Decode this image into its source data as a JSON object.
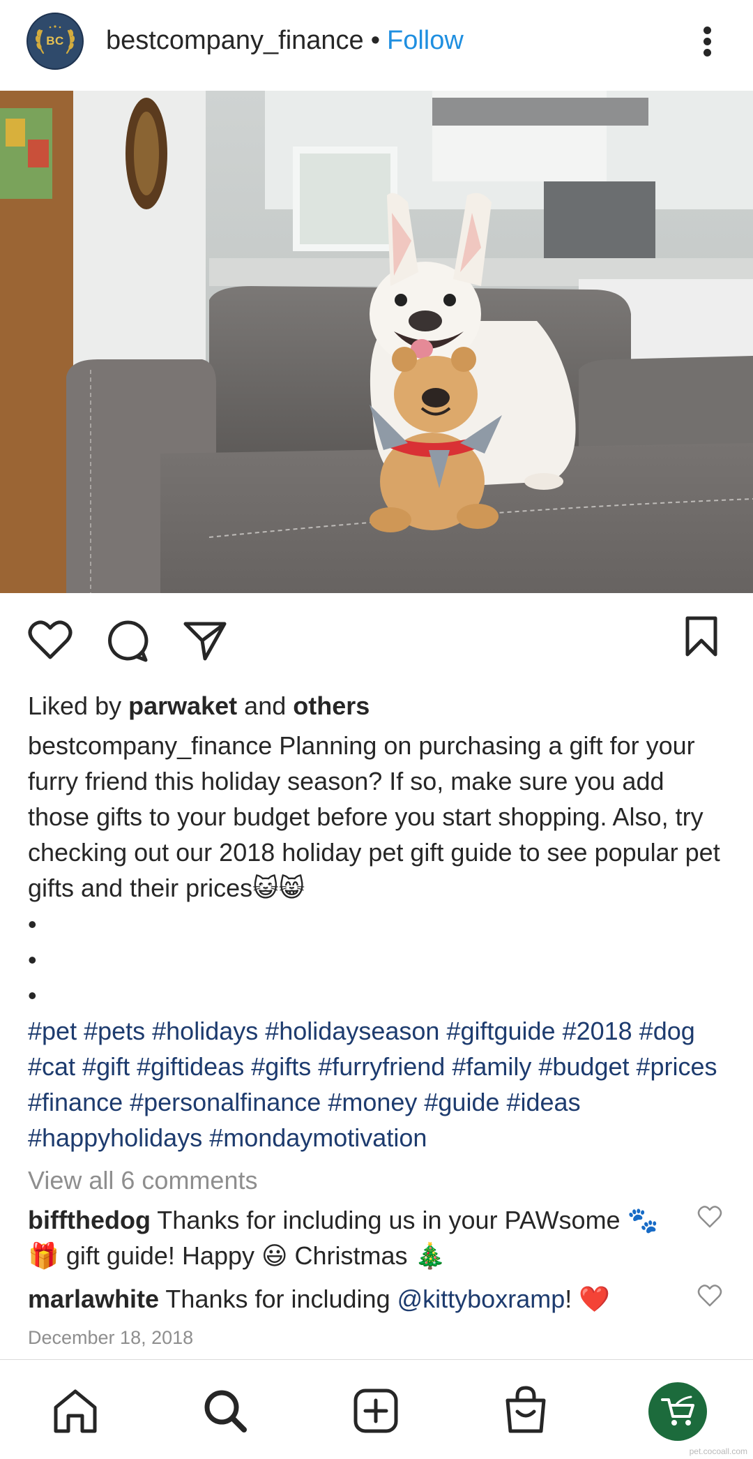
{
  "post": {
    "avatar_initials": "BC",
    "username": "bestcompany_finance",
    "separator": "•",
    "follow_label": "Follow"
  },
  "photo": {
    "icon": "photo-french-bulldog-with-plush-toy-on-couch"
  },
  "actions": {
    "like_icon": "heart-icon",
    "comment_icon": "comment-bubble-icon",
    "share_icon": "send-paper-plane-icon",
    "save_icon": "bookmark-icon"
  },
  "likes": {
    "prefix": "Liked by ",
    "user": "parwaket",
    "middle": " and ",
    "others": "others"
  },
  "caption": {
    "username": "bestcompany_finance",
    "text": " Planning on purchasing a gift for your furry friend this holiday season? If so, make sure you add those gifts to your budget before you start shopping. Also, try checking out our 2018 holiday pet gift guide to see popular pet gifts and their prices😺😸",
    "bullets": [
      "•",
      "•",
      "•"
    ],
    "hashtags": "#pet #pets #holidays #holidayseason #giftguide #2018 #dog #cat #gift #giftideas #gifts #furryfriend #family #budget #prices #finance #personalfinance #money #guide #ideas #happyholidays #mondaymotivation"
  },
  "comments": {
    "view_all": "View all 6 comments",
    "items": [
      {
        "user": "biffthedog",
        "text": " Thanks for including us in your PAWsome 🐾 🎁 gift guide! Happy 😃 Christmas 🎄"
      },
      {
        "user": "marlawhite",
        "text_before": " Thanks for including ",
        "mention": "@kittyboxramp",
        "text_after": "! ❤️"
      }
    ]
  },
  "date": "December 18, 2018",
  "nav": {
    "items": [
      "home-icon",
      "search-icon",
      "create-post-icon",
      "shopping-bag-icon",
      "profile-shopping-cart-icon"
    ]
  },
  "watermark": "pet.cocoall.com",
  "colors": {
    "follow": "#1f8fe0",
    "hashtag": "#1d3b6e",
    "muted": "#8e8e8e",
    "heart_red": "#e0302d",
    "profile_green": "#1c6b3c"
  }
}
